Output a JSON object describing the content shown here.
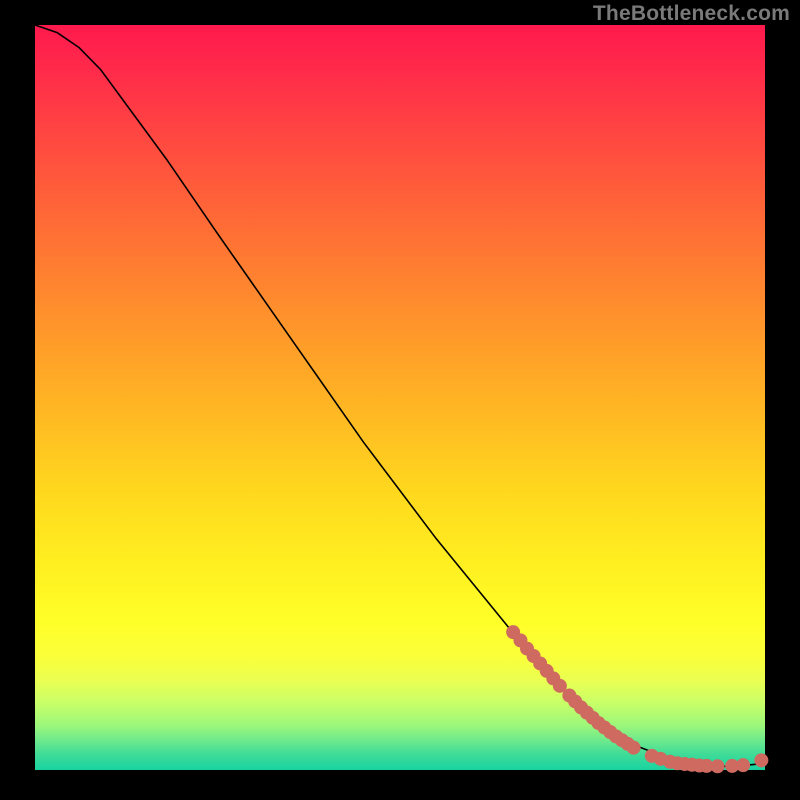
{
  "watermark": "TheBottleneck.com",
  "colors": {
    "background": "#000000",
    "curve": "#000000",
    "point": "#cf6a60"
  },
  "chart_data": {
    "type": "line",
    "title": "",
    "xlabel": "",
    "ylabel": "",
    "xlim": [
      0,
      100
    ],
    "ylim": [
      0,
      100
    ],
    "series": [
      {
        "name": "curve",
        "x": [
          0,
          3,
          6,
          9,
          12,
          18,
          25,
          35,
          45,
          55,
          65,
          72,
          78,
          83,
          87,
          90,
          93,
          96,
          99,
          100
        ],
        "y": [
          100,
          99,
          97,
          94,
          90,
          82,
          72,
          58,
          44,
          31,
          19,
          11,
          6,
          3,
          1.5,
          0.8,
          0.5,
          0.5,
          0.8,
          1.4
        ]
      }
    ],
    "points": [
      {
        "x": 65.5,
        "y": 18.5
      },
      {
        "x": 66.5,
        "y": 17.4
      },
      {
        "x": 67.4,
        "y": 16.3
      },
      {
        "x": 68.3,
        "y": 15.3
      },
      {
        "x": 69.2,
        "y": 14.3
      },
      {
        "x": 70.1,
        "y": 13.3
      },
      {
        "x": 71.0,
        "y": 12.3
      },
      {
        "x": 71.9,
        "y": 11.3
      },
      {
        "x": 73.2,
        "y": 10.0
      },
      {
        "x": 74.0,
        "y": 9.2
      },
      {
        "x": 74.8,
        "y": 8.4
      },
      {
        "x": 75.6,
        "y": 7.7
      },
      {
        "x": 76.4,
        "y": 7.0
      },
      {
        "x": 77.2,
        "y": 6.3
      },
      {
        "x": 78.0,
        "y": 5.7
      },
      {
        "x": 78.8,
        "y": 5.1
      },
      {
        "x": 79.6,
        "y": 4.5
      },
      {
        "x": 80.4,
        "y": 4.0
      },
      {
        "x": 81.2,
        "y": 3.5
      },
      {
        "x": 82.0,
        "y": 3.0
      },
      {
        "x": 84.5,
        "y": 1.9
      },
      {
        "x": 85.7,
        "y": 1.5
      },
      {
        "x": 87.0,
        "y": 1.1
      },
      {
        "x": 88.0,
        "y": 0.9
      },
      {
        "x": 89.0,
        "y": 0.8
      },
      {
        "x": 90.0,
        "y": 0.7
      },
      {
        "x": 91.0,
        "y": 0.6
      },
      {
        "x": 92.0,
        "y": 0.55
      },
      {
        "x": 93.5,
        "y": 0.5
      },
      {
        "x": 95.5,
        "y": 0.55
      },
      {
        "x": 97.0,
        "y": 0.65
      },
      {
        "x": 99.5,
        "y": 1.3
      }
    ],
    "gradient_stops": [
      {
        "pos": 0.0,
        "color": "#ff1a4d"
      },
      {
        "pos": 0.3,
        "color": "#ff7a33"
      },
      {
        "pos": 0.6,
        "color": "#ffd020"
      },
      {
        "pos": 0.82,
        "color": "#ffff2a"
      },
      {
        "pos": 1.0,
        "color": "#18d3a0"
      }
    ]
  }
}
